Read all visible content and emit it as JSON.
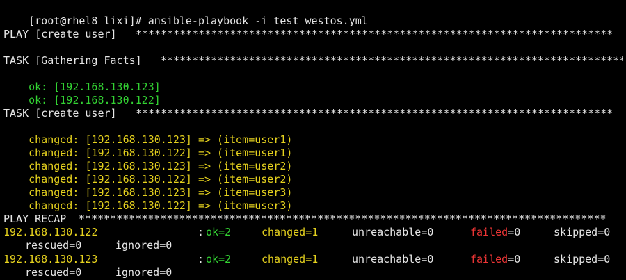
{
  "terminal": {
    "prompt": "[root@rhel8 lixi]# ansible-playbook -i test westos.yml",
    "play": {
      "header": "PLAY [create user] ",
      "stars": "****************************************************************************"
    },
    "task_facts": {
      "header": "TASK [Gathering Facts] ",
      "stars": "**************************************************************************",
      "results": [
        "ok: [192.168.130.123]",
        "ok: [192.168.130.122]"
      ]
    },
    "task_create": {
      "header": "TASK [create user] ",
      "stars": "****************************************************************************",
      "results": [
        "changed: [192.168.130.123] => (item=user1)",
        "changed: [192.168.130.122] => (item=user1)",
        "changed: [192.168.130.123] => (item=user2)",
        "changed: [192.168.130.122] => (item=user2)",
        "changed: [192.168.130.123] => (item=user3)",
        "changed: [192.168.130.122] => (item=user3)"
      ]
    },
    "recap": {
      "header": "PLAY RECAP ",
      "stars": "************************************************************************************",
      "hosts": [
        {
          "host": "192.168.130.122",
          "colon": ": ",
          "ok": "ok=2",
          "changed": "changed=1",
          "unreachable": "unreachable=0",
          "failed_word": "failed",
          "failed_value": "=0",
          "skipped": "skipped=0",
          "rescued": "rescued=0",
          "ignored": "ignored=0"
        },
        {
          "host": "192.168.130.123",
          "colon": ": ",
          "ok": "ok=2",
          "changed": "changed=1",
          "unreachable": "unreachable=0",
          "failed_word": "failed",
          "failed_value": "=0",
          "skipped": "skipped=0",
          "rescued": "rescued=0",
          "ignored": "ignored=0"
        }
      ]
    },
    "colors": {
      "background": "#000000",
      "default": "#e6e6e6",
      "ok": "#33d333",
      "changed": "#e6d21e",
      "failed": "#ee3535"
    }
  }
}
